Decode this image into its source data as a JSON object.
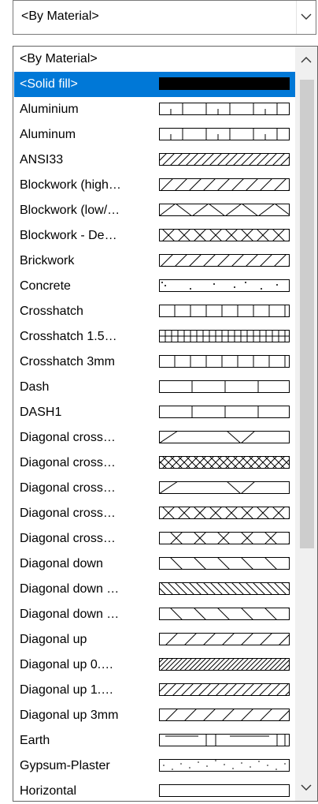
{
  "combo": {
    "value": "<By Material>"
  },
  "list": {
    "items": [
      {
        "label": "<By Material>",
        "pattern": "none"
      },
      {
        "label": "<Solid fill>",
        "pattern": "solid",
        "selected": true
      },
      {
        "label": "Aluminium",
        "pattern": "grid-aluminium"
      },
      {
        "label": "Aluminum",
        "pattern": "grid-aluminium"
      },
      {
        "label": "ANSI33",
        "pattern": "diag-dashed"
      },
      {
        "label": "Blockwork (high…",
        "pattern": "diag-sparse"
      },
      {
        "label": "Blockwork (low/…",
        "pattern": "zigzag"
      },
      {
        "label": "Blockwork - De…",
        "pattern": "crosshatch-x"
      },
      {
        "label": "Brickwork",
        "pattern": "diag-brick"
      },
      {
        "label": "Concrete",
        "pattern": "dots"
      },
      {
        "label": "Crosshatch",
        "pattern": "vertical-medium"
      },
      {
        "label": "Crosshatch 1.5…",
        "pattern": "vertical-dense"
      },
      {
        "label": "Crosshatch 3mm",
        "pattern": "vertical-medium"
      },
      {
        "label": "Dash",
        "pattern": "vertical-sparse"
      },
      {
        "label": "DASH1",
        "pattern": "vertical-sparse"
      },
      {
        "label": "Diagonal cross…",
        "pattern": "diag-cross-sparse"
      },
      {
        "label": "Diagonal cross…",
        "pattern": "crosshatch-dense"
      },
      {
        "label": "Diagonal cross…",
        "pattern": "diag-cross-sparse"
      },
      {
        "label": "Diagonal cross…",
        "pattern": "crosshatch-x"
      },
      {
        "label": "Diagonal cross…",
        "pattern": "crosshatch-x-wide"
      },
      {
        "label": "Diagonal down",
        "pattern": "down-sparse"
      },
      {
        "label": "Diagonal down …",
        "pattern": "down-dense"
      },
      {
        "label": "Diagonal down …",
        "pattern": "down-sparse"
      },
      {
        "label": "Diagonal up",
        "pattern": "up-medium"
      },
      {
        "label": "Diagonal up 0.…",
        "pattern": "up-dense"
      },
      {
        "label": "Diagonal up 1.…",
        "pattern": "up-dense2"
      },
      {
        "label": "Diagonal up 3mm",
        "pattern": "up-medium"
      },
      {
        "label": "Earth",
        "pattern": "earth"
      },
      {
        "label": "Gypsum-Plaster",
        "pattern": "dots-sparse"
      },
      {
        "label": "Horizontal",
        "pattern": "plain"
      }
    ]
  },
  "colors": {
    "selection": "#0078d7",
    "scrollbar_track": "#f0f0f0",
    "scrollbar_thumb": "#cdcdcd"
  },
  "icons": {
    "combo_arrow": "chevron-down-icon",
    "scroll_up": "chevron-up-icon",
    "scroll_down": "chevron-down-icon"
  }
}
